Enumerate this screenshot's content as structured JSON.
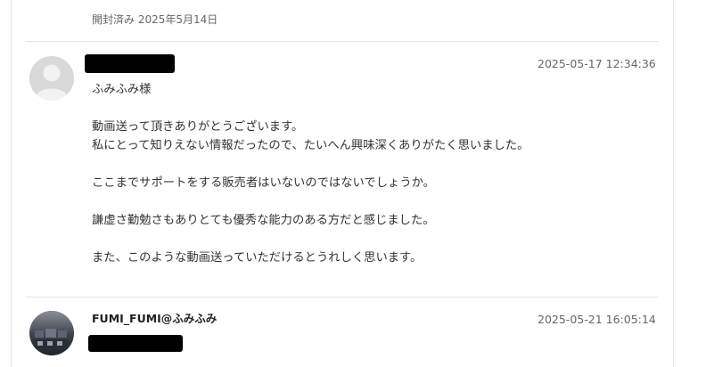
{
  "opened_status": "開封済み 2025年5月14日",
  "messages": [
    {
      "sender": "",
      "timestamp": "2025-05-17 12:34:36",
      "greeting": "ふみふみ様",
      "body": [
        "動画送って頂きありがとうございます。",
        "私にとって知りえない情報だったので、たいへん興味深くありがたく思いました。",
        "ここまでサポートをする販売者はいないのではないでしょうか。",
        "謙虚さ勤勉さもありとても優秀な能力のある方だと感じました。",
        "また、このような動画送っていただけるとうれしく思います。"
      ]
    },
    {
      "sender": "FUMI_FUMI@ふみふみ",
      "timestamp": "2025-05-21 16:05:14"
    }
  ],
  "icons": {
    "avatar_default": "default-user-avatar-icon",
    "avatar_photo": "user-photo-avatar"
  },
  "colors": {
    "border": "#e3e3e3",
    "muted_text": "#666666",
    "body_text": "#333333",
    "redaction": "#000000"
  }
}
